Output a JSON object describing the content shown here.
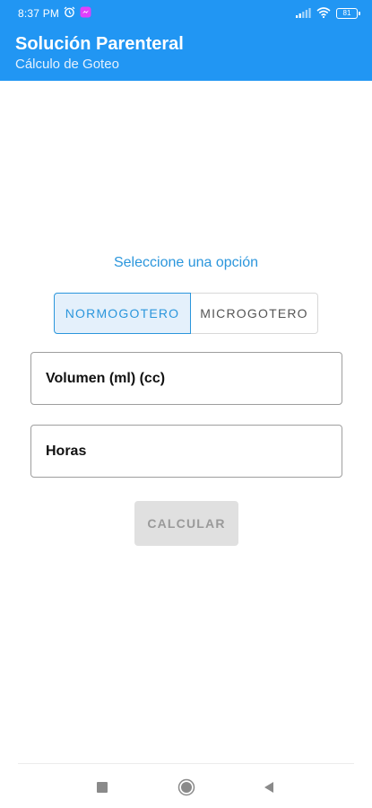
{
  "status_bar": {
    "time": "8:37 PM",
    "battery": "81"
  },
  "app_bar": {
    "title": "Solución Parenteral",
    "subtitle": "Cálculo de Goteo"
  },
  "form": {
    "prompt": "Seleccione una opción",
    "options": [
      {
        "label": "NORMOGOTERO",
        "selected": true
      },
      {
        "label": "MICROGOTERO",
        "selected": false
      }
    ],
    "volume_placeholder": "Volumen (ml) (cc)",
    "hours_placeholder": "Horas",
    "calculate_label": "CALCULAR"
  },
  "colors": {
    "primary": "#2196f3",
    "accent_text": "#2b96dc",
    "button_disabled_bg": "#e0e0e0",
    "button_disabled_text": "#9a9a9a"
  },
  "icons": {
    "status_left": [
      "alarm-icon",
      "messenger-icon"
    ],
    "status_right": [
      "signal-icon",
      "wifi-icon",
      "battery-icon"
    ],
    "navigation": [
      "recent-apps-icon",
      "home-icon",
      "back-icon"
    ]
  }
}
